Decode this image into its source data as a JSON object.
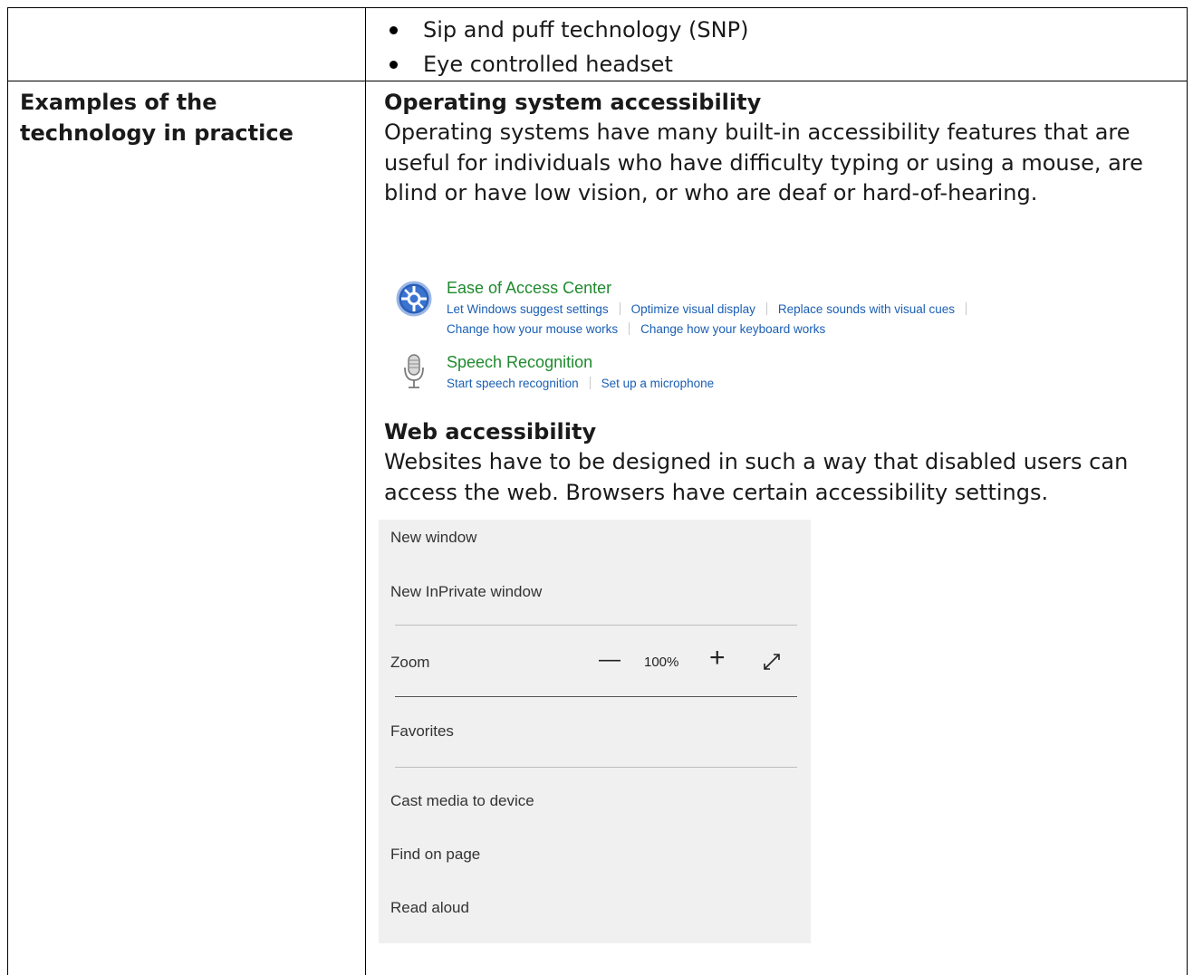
{
  "bullets": [
    "Sip and puff technology (SNP)",
    "Eye controlled headset"
  ],
  "row_label": "Examples of the technology in practice",
  "os_section": {
    "title": "Operating system accessibility",
    "body": "Operating systems have many built-in accessibility features that are useful for individuals who have difficulty typing or using a mouse, are blind or have low vision, or who are deaf or hard-of-hearing."
  },
  "control_panel": {
    "ease": {
      "title": "Ease of Access Center",
      "links_line1": [
        "Let Windows suggest settings",
        "Optimize visual display",
        "Replace sounds with visual cues"
      ],
      "links_line2": [
        "Change how your mouse works",
        "Change how your keyboard works"
      ]
    },
    "speech": {
      "title": "Speech Recognition",
      "links": [
        "Start speech recognition",
        "Set up a microphone"
      ]
    },
    "title_color": "#1f8a2e",
    "link_color": "#1a5fb4"
  },
  "web_section": {
    "title": "Web accessibility",
    "body": "Websites have to be designed in such a way that disabled users can access the web. Browsers have certain accessibility settings."
  },
  "browser_menu": {
    "new_window": "New window",
    "new_inprivate": "New InPrivate window",
    "zoom_label": "Zoom",
    "zoom_minus": "—",
    "zoom_value": "100%",
    "zoom_plus": "+",
    "zoom_fullscreen_icon": "expand-arrows-icon",
    "favorites": "Favorites",
    "cast": "Cast media to device",
    "find": "Find on page",
    "read_aloud": "Read aloud"
  }
}
